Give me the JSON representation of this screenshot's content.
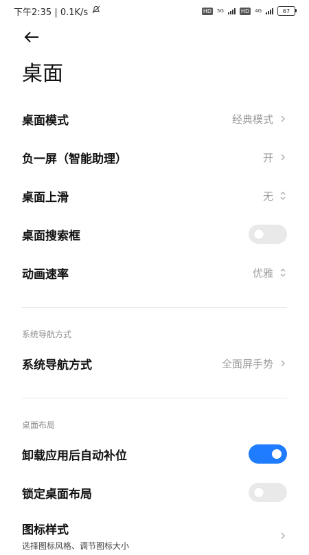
{
  "status_bar": {
    "time_speed": "下午2:35 | 0.1K/s",
    "net1": "5G",
    "net2": "4G",
    "hd": "HD",
    "battery": "67"
  },
  "page": {
    "title": "桌面"
  },
  "settings": {
    "desktop_mode": {
      "label": "桌面模式",
      "value": "经典模式"
    },
    "minus_one": {
      "label": "负一屏（智能助理）",
      "value": "开"
    },
    "swipe_up": {
      "label": "桌面上滑",
      "value": "无"
    },
    "search_box": {
      "label": "桌面搜索框",
      "toggle": "off"
    },
    "anim_rate": {
      "label": "动画速率",
      "value": "优雅"
    }
  },
  "sections": {
    "nav": {
      "header": "系统导航方式",
      "row": {
        "label": "系统导航方式",
        "value": "全面屏手势"
      }
    },
    "layout": {
      "header": "桌面布局",
      "auto_fill": {
        "label": "卸载应用后自动补位",
        "toggle": "on"
      },
      "lock_layout": {
        "label": "锁定桌面布局",
        "toggle": "off"
      },
      "icon_style": {
        "label": "图标样式",
        "subtitle": "选择图标风格、调节图标大小"
      }
    }
  },
  "colors": {
    "accent": "#1f7cff",
    "toggle_off": "#e9e9e9",
    "secondary_text": "#9b9b9b"
  }
}
